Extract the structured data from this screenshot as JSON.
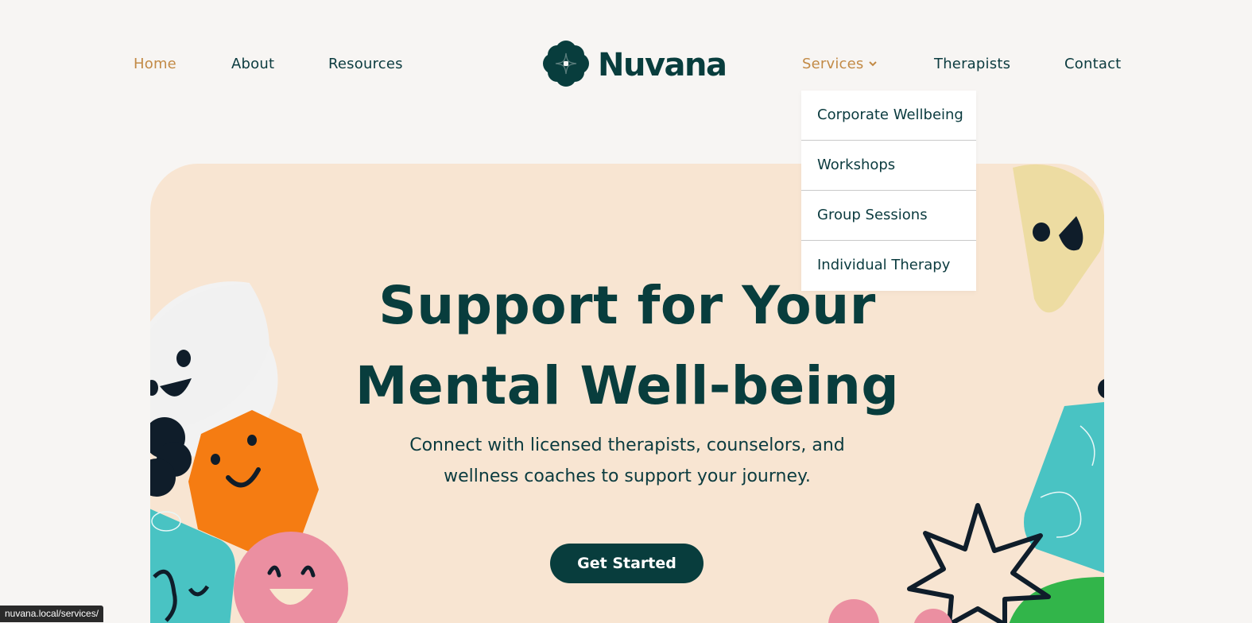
{
  "nav": {
    "left": [
      {
        "label": "Home",
        "active": true
      },
      {
        "label": "About",
        "active": false
      },
      {
        "label": "Resources",
        "active": false
      }
    ],
    "logo_text": "Nuvana",
    "right": [
      {
        "label": "Services",
        "active": true,
        "has_dropdown": true
      },
      {
        "label": "Therapists",
        "active": false
      },
      {
        "label": "Contact",
        "active": false
      }
    ]
  },
  "services_dropdown": {
    "items": [
      "Corporate Wellbeing",
      "Workshops",
      "Group Sessions",
      "Individual Therapy"
    ]
  },
  "hero": {
    "title_line1": "Support for Your",
    "title_line2": "Mental Well-being",
    "subtitle_line1": "Connect with licensed therapists, counselors, and",
    "subtitle_line2": "wellness coaches to support your journey.",
    "cta_label": "Get Started"
  },
  "status_bar": {
    "url": "nuvana.local/services/"
  },
  "colors": {
    "primary": "#083d3d",
    "accent": "#c28a46",
    "hero_bg": "#f8e5d2",
    "page_bg": "#f7f5f3"
  },
  "icons": {
    "logo": "flower-logo-icon",
    "dropdown": "chevron-down-icon"
  }
}
